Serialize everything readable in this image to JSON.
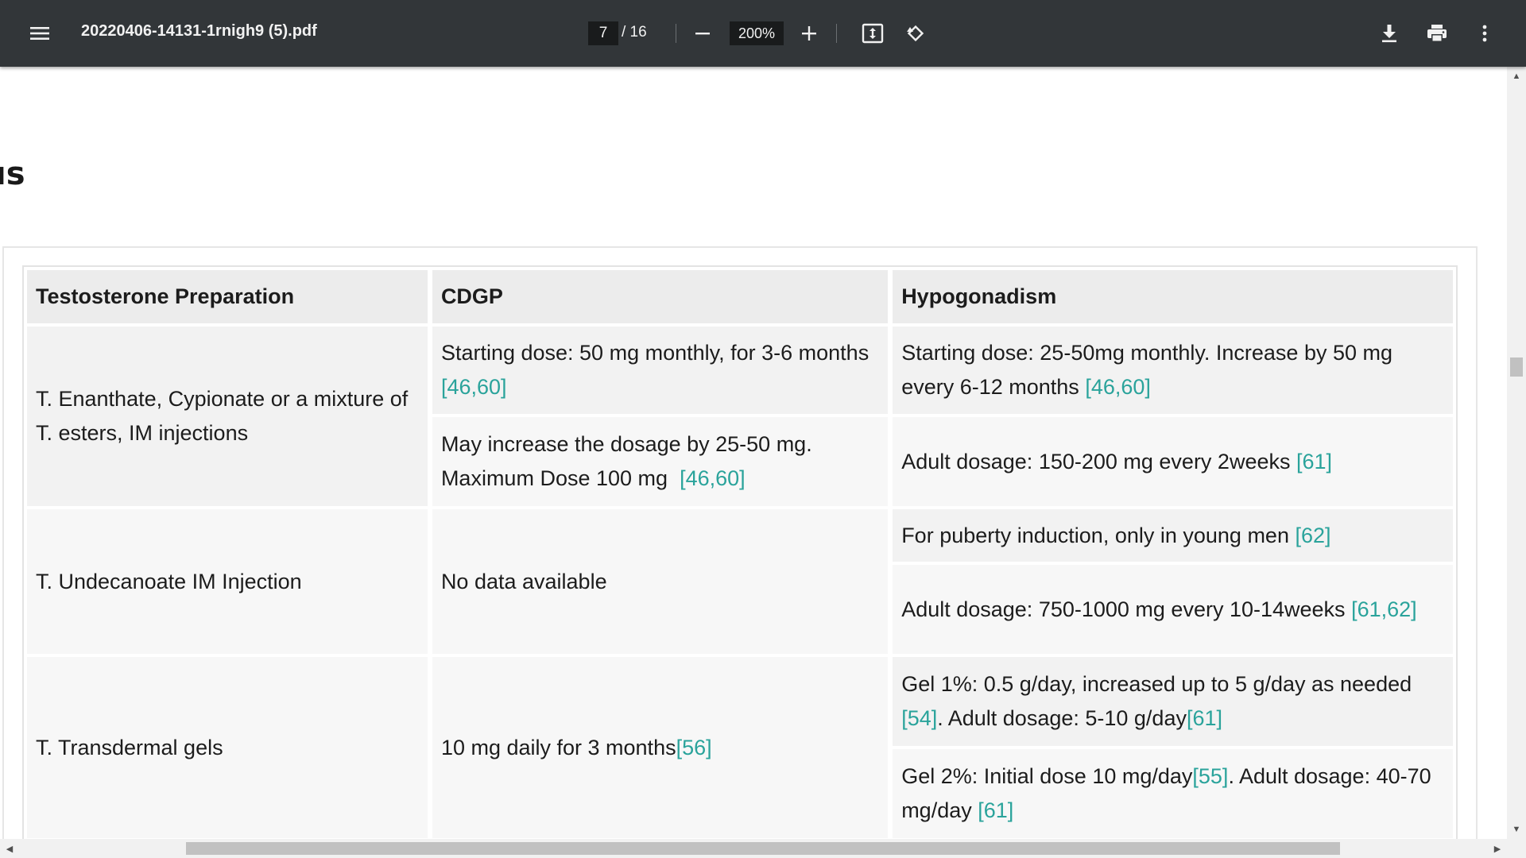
{
  "toolbar": {
    "menu_icon": "hamburger-menu-icon",
    "title": "20220406-14131-1rnigh9 (5).pdf",
    "current_page": "7",
    "page_total": "/ 16",
    "zoom_level": "200%",
    "icons": {
      "zoom_out": "minus-icon",
      "zoom_in": "plus-icon",
      "fit_page": "fit-to-page-icon",
      "rotate": "rotate-counterclockwise-icon",
      "download": "download-icon",
      "print": "print-icon",
      "more": "more-vertical-icon"
    },
    "colors": {
      "background": "#323639",
      "input_background": "#191b1c",
      "text": "#f1f1f1"
    }
  },
  "document": {
    "heading_fragment": "ıs",
    "reference_color": "#2aa39b",
    "table": {
      "headers": [
        "Testosterone Preparation",
        "CDGP",
        "Hypogonadism"
      ],
      "rows": {
        "enanthate": {
          "prep": "T. Enanthate, Cypionate or a mixture of T. esters, IM injections",
          "cdgp_1_text": "Starting dose: 50 mg monthly, for 3-6 months",
          "cdgp_1_ref": "[46,60]",
          "hypo_1_text": "Starting dose: 25-50mg monthly. Increase by 50 mg every 6-12 months",
          "hypo_1_ref": "[46,60]",
          "cdgp_2_text": "May increase the dosage by 25-50 mg. Maximum Dose 100 mg",
          "cdgp_2_ref": "[46,60]",
          "hypo_2_text": "Adult dosage: 150-200 mg every 2weeks",
          "hypo_2_ref": "[61]"
        },
        "undecanoate": {
          "prep": "T. Undecanoate IM Injection",
          "cdgp": "No data available",
          "hypo_1_text": "For puberty induction, only in young men",
          "hypo_1_ref": "[62]",
          "hypo_2_text": "Adult dosage: 750-1000 mg every 10-14weeks",
          "hypo_2_ref": "[61,62]"
        },
        "gels": {
          "prep": "T. Transdermal gels",
          "cdgp_text": "10 mg daily for 3 months",
          "cdgp_ref": "[56]",
          "hypo_1_text_a": "Gel 1%: 0.5 g/day, increased up to 5 g/day as needed",
          "hypo_1_ref_a": "[54]",
          "hypo_1_text_b": ". Adult dosage: 5-10 g/day",
          "hypo_1_ref_b": "[61]",
          "hypo_2_text_a": "Gel 2%: Initial dose 10 mg/day",
          "hypo_2_ref_a": "[55]",
          "hypo_2_text_b": ". Adult dosage: 40-70 mg/day",
          "hypo_2_ref_b": "[61]"
        }
      }
    }
  },
  "scrollbars": {
    "up_arrow": "▲",
    "down_arrow": "▼",
    "left_arrow": "◀",
    "right_arrow": "▶"
  }
}
